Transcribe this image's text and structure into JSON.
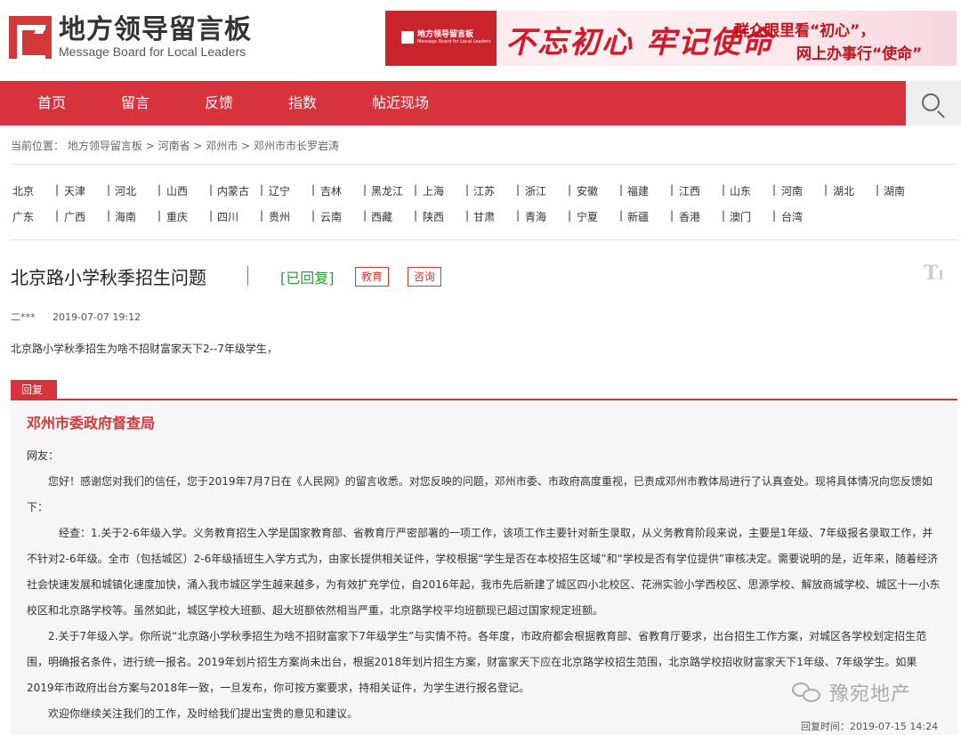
{
  "header": {
    "logo_cn": "地方领导留言板",
    "logo_en": "Message Board for Local Leaders"
  },
  "banner": {
    "logo_cn": "地方领导留言板",
    "logo_en": "Message Board for Local Leaders",
    "slogan": "不忘初心 牢记使命",
    "line1": "群众眼里看“初心”，",
    "line2": "网上办事行“使命”"
  },
  "nav": {
    "items": [
      "首页",
      "留言",
      "反馈",
      "指数",
      "帖近现场"
    ],
    "search_icon": "search-icon"
  },
  "breadcrumb": {
    "prefix": "当前位置：",
    "items": [
      "地方领导留言板",
      "河南省",
      "邓州市",
      "邓州市市长罗岩涛"
    ],
    "separator": ">"
  },
  "provinces": {
    "row1": [
      "北京",
      "天津",
      "河北",
      "山西",
      "内蒙古",
      "辽宁",
      "吉林",
      "黑龙江",
      "上海",
      "江苏",
      "浙江",
      "安徽",
      "福建",
      "江西",
      "山东",
      "河南",
      "湖北",
      "湖南"
    ],
    "row2": [
      "广东",
      "广西",
      "海南",
      "重庆",
      "四川",
      "贵州",
      "云南",
      "西藏",
      "陕西",
      "甘肃",
      "青海",
      "宁夏",
      "新疆",
      "香港",
      "澳门",
      "台湾"
    ]
  },
  "message": {
    "title": "北京路小学秋季招生问题",
    "status": "[已回复]",
    "tags": [
      "教育",
      "咨询"
    ],
    "font_tool": "T",
    "author": "二***",
    "date": "2019-07-07 19:12",
    "content": "北京路小学秋季招生为啥不招财富家天下2--7年级学生，"
  },
  "reply": {
    "tab_label": "回复",
    "org": "邓州市委政府督查局",
    "paragraphs": [
      "网友：",
      "　　您好！感谢您对我们的信任，您于2019年7月7日在《人民网》的留言收悉。对您反映的问题，邓州市委、市政府高度重视，已责成邓州市教体局进行了认真查处。现将具体情况向您反馈如下：",
      "　　　经查：1.关于2-6年级入学。义务教育招生入学是国家教育部、省教育厅严密部署的一项工作，该项工作主要针对新生录取，从义务教育阶段来说，主要是1年级、7年级报名录取工作，并不针对2-6年级。全市（包括城区）2-6年级插班生入学方式为，由家长提供相关证件，学校根据“学生是否在本校招生区域”和“学校是否有学位提供”审核决定。需要说明的是，近年来，随着经济社会快速发展和城镇化速度加快，涌入我市城区学生越来越多，为有效扩充学位，自2016年起，我市先后新建了城区四小北校区、花洲实验小学西校区、思源学校、解放商城学校、城区十一小东校区和北京路学校等。虽然如此，城区学校大班额、超大班额依然相当严重，北京路学校平均班额现已超过国家规定班额。",
      "　　2.关于7年级入学。你所说“北京路小学秋季招生为啥不招财富家下7年级学生”与实情不符。各年度，市政府都会根据教育部、省教育厅要求，出台招生工作方案，对城区各学校划定招生范围，明确报名条件，进行统一报名。2019年划片招生方案尚未出台，根据2018年划片招生方案，财富家天下应在北京路学校招生范围，北京路学校招收财富家天下1年级、7年级学生。如果2019年市政府出台方案与2018年一致，一旦发布，你可按方案要求，持相关证件，为学生进行报名登记。",
      "　　欢迎你继续关注我们的工作，及时给我们提出宝贵的意见和建议。"
    ],
    "time": "回复时间：2019-07-15 14:24"
  },
  "watermark": {
    "text": "豫宛地产",
    "icon": "wechat-icon"
  },
  "colors": {
    "brand_red": "#d6333d",
    "status_green": "#2e9e3a",
    "reply_bg": "#f6f6f6"
  }
}
